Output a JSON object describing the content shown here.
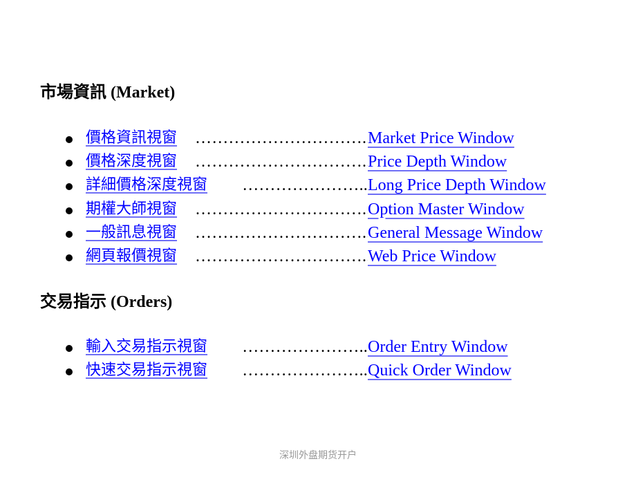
{
  "sections": [
    {
      "title": "市場資訊  (Market)",
      "items": [
        {
          "cn": "價格資訊視窗",
          "leader": "…………………………..",
          "en": "Market Price Window"
        },
        {
          "cn": "價格深度視窗",
          "leader": "…………………………..",
          "en": "Price Depth Window"
        },
        {
          "cn": "詳細價格深度視窗",
          "leader": "…………………..",
          "en": "Long Price Depth Window"
        },
        {
          "cn": "期權大師視窗",
          "leader": "…………………………..",
          "en": "Option Master Window"
        },
        {
          "cn": "一般訊息視窗",
          "leader": "…………………………..",
          "en": "General Message Window"
        },
        {
          "cn": "網頁報價視窗",
          "leader": "…………………………..",
          "en": "Web Price Window"
        }
      ]
    },
    {
      "title": "交易指示 (Orders)",
      "items": [
        {
          "cn": "輸入交易指示視窗",
          "leader": "…………………..",
          "en": "Order Entry Window"
        },
        {
          "cn": "快速交易指示視窗",
          "leader": "…………………..",
          "en": "Quick Order Window"
        }
      ]
    }
  ],
  "footer": "深圳外盘期货开户",
  "colors": {
    "link": "#0000ff",
    "link_underline": "#6f6ff5",
    "footer": "#999999"
  }
}
